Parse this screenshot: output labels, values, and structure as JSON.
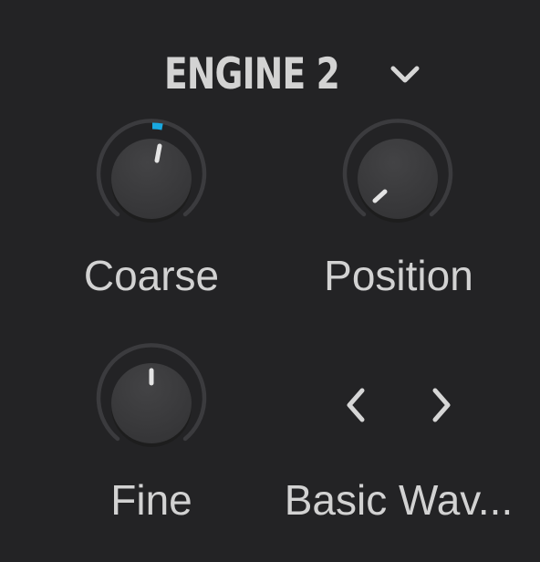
{
  "engine": {
    "title": "ENGINE 2"
  },
  "icons": {
    "dropdown": "chevron-down-icon",
    "prev": "chevron-left-icon",
    "next": "chevron-right-icon"
  },
  "knobs": {
    "coarse": {
      "label": "Coarse",
      "value": 0.5
    },
    "position": {
      "label": "Position",
      "value": 0.0
    },
    "fine": {
      "label": "Fine",
      "value": 0.5
    }
  },
  "wavetable": {
    "label": "Basic Wav..."
  },
  "colors": {
    "background": "#232325",
    "accent": "#19a8e0",
    "text": "#d2d2d2",
    "track": "#3b3b3e",
    "knob_body": "#3a3a3c",
    "pointer": "#e4e4e4"
  }
}
